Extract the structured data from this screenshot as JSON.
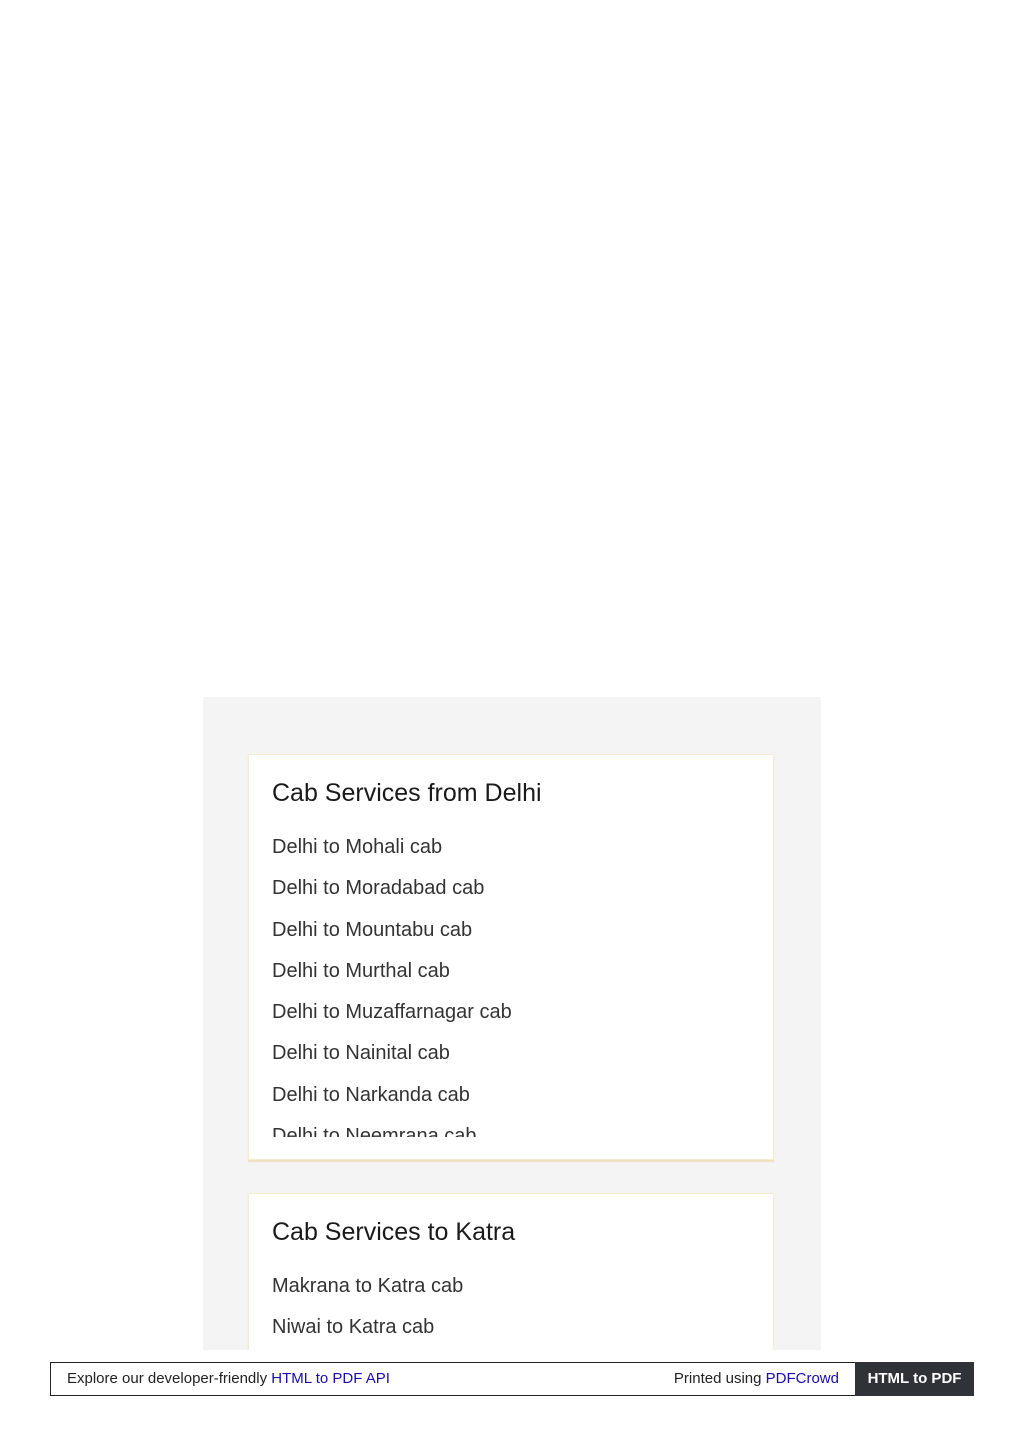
{
  "sections": [
    {
      "title": "Cab Services from Delhi",
      "links": [
        "Delhi to Mohali cab",
        "Delhi to Moradabad cab",
        "Delhi to Mountabu cab",
        "Delhi to Murthal cab",
        "Delhi to Muzaffarnagar cab",
        "Delhi to Nainital cab",
        "Delhi to Narkanda cab",
        "Delhi to Neemrana cab"
      ]
    },
    {
      "title": "Cab Services to Katra",
      "links": [
        "Makrana to Katra cab",
        "Niwai to Katra cab"
      ]
    }
  ],
  "footer": {
    "explore_text": "Explore our developer-friendly",
    "explore_link": "HTML to PDF API",
    "printed_text": "Printed using",
    "printed_link": "PDFCrowd",
    "cta_label": "HTML to PDF"
  }
}
